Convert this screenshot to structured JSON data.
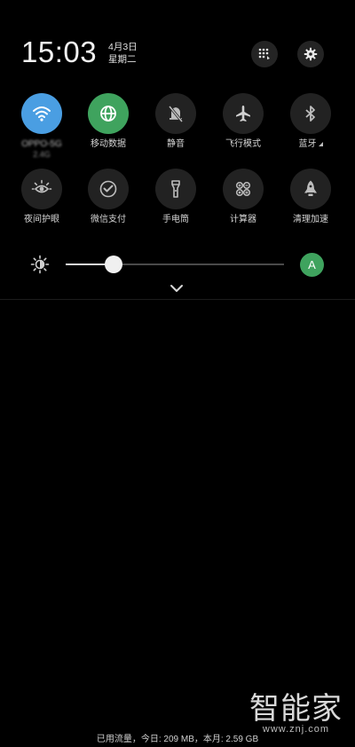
{
  "status": {
    "time": "15:03",
    "date_line1": "4月3日",
    "date_line2": "星期二"
  },
  "header": {
    "edit_icon": "grid-edit-icon",
    "settings_icon": "gear-icon"
  },
  "tiles_row1": [
    {
      "id": "wifi",
      "label": "OPPO-5G",
      "sub": "2.4G",
      "icon": "wifi-icon",
      "state": "on",
      "color": "#4a9ee2"
    },
    {
      "id": "mobile-data",
      "label": "移动数据",
      "icon": "globe-icon",
      "state": "on",
      "color": "#3fa35e"
    },
    {
      "id": "silent",
      "label": "静音",
      "icon": "bell-off-icon",
      "state": "off"
    },
    {
      "id": "airplane",
      "label": "飞行模式",
      "icon": "airplane-icon",
      "state": "off"
    },
    {
      "id": "bluetooth",
      "label": "蓝牙",
      "icon": "bluetooth-icon",
      "state": "off"
    }
  ],
  "tiles_row2": [
    {
      "id": "eye-care",
      "label": "夜间护眼",
      "icon": "eye-care-icon",
      "state": "off"
    },
    {
      "id": "wechat-pay",
      "label": "微信支付",
      "icon": "wechat-pay-icon",
      "state": "off"
    },
    {
      "id": "flashlight",
      "label": "手电筒",
      "icon": "flashlight-icon",
      "state": "off"
    },
    {
      "id": "calculator",
      "label": "计算器",
      "icon": "calculator-icon",
      "state": "off"
    },
    {
      "id": "boost",
      "label": "清理加速",
      "icon": "rocket-icon",
      "state": "off"
    }
  ],
  "brightness": {
    "level": 0.22,
    "auto_label": "A",
    "icon": "brightness-icon"
  },
  "footer": {
    "data_usage": "已用流量，今日: 209 MB，本月: 2.59 GB"
  },
  "watermark": {
    "main": "智能家",
    "sub": "www.znj.com"
  }
}
